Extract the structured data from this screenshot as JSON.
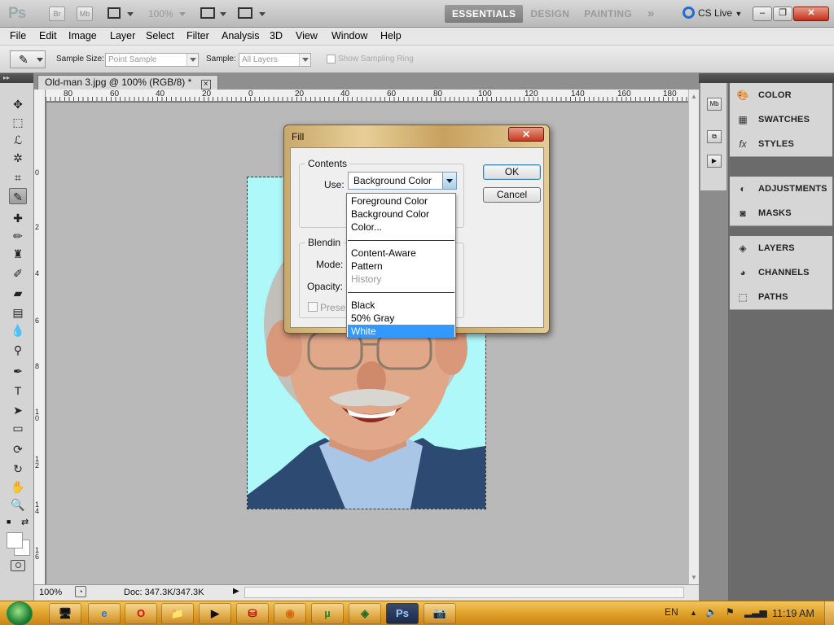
{
  "app": {
    "logo": "Ps",
    "zoom": "100%",
    "workspaces": [
      "ESSENTIALS",
      "DESIGN",
      "PAINTING"
    ],
    "active_workspace": "ESSENTIALS",
    "more": "»",
    "cs_live": "CS Live",
    "bridge_btn": "Br",
    "minibridge_btn": "Mb"
  },
  "menu": [
    "File",
    "Edit",
    "Image",
    "Layer",
    "Select",
    "Filter",
    "Analysis",
    "3D",
    "View",
    "Window",
    "Help"
  ],
  "options": {
    "sample_size_label": "Sample Size:",
    "sample_size_value": "Point Sample",
    "sample_label": "Sample:",
    "sample_value": "All Layers",
    "show_ring_label": "Show Sampling Ring"
  },
  "document": {
    "tab_title": "Old-man 3.jpg @ 100% (RGB/8) *",
    "close": "×",
    "ruler_top": [
      "80",
      "60",
      "40",
      "20",
      "0",
      "20",
      "40",
      "60",
      "80",
      "100",
      "120",
      "140",
      "160",
      "180"
    ],
    "ruler_left": [
      "0",
      "2",
      "4",
      "6",
      "8",
      "10",
      "12",
      "14",
      "16"
    ],
    "status_zoom": "100%",
    "status_doc": "Doc: 347.3K/347.3K"
  },
  "panels": {
    "group1": [
      {
        "label": "COLOR",
        "icon": "color-icon"
      },
      {
        "label": "SWATCHES",
        "icon": "swatches-icon"
      },
      {
        "label": "STYLES",
        "icon": "styles-icon"
      }
    ],
    "group2": [
      {
        "label": "ADJUSTMENTS",
        "icon": "adjustments-icon"
      },
      {
        "label": "MASKS",
        "icon": "masks-icon"
      }
    ],
    "group3": [
      {
        "label": "LAYERS",
        "icon": "layers-icon"
      },
      {
        "label": "CHANNELS",
        "icon": "channels-icon"
      },
      {
        "label": "PATHS",
        "icon": "paths-icon"
      }
    ]
  },
  "dialog": {
    "title": "Fill",
    "close": "✕",
    "contents_legend": "Contents",
    "use_label": "Use:",
    "use_value": "Background Color",
    "blending_legend": "Blendin",
    "mode_label": "Mode:",
    "opacity_label": "Opacity:",
    "preserve_label": "Preser",
    "ok": "OK",
    "cancel": "Cancel"
  },
  "dropdown": {
    "group1": [
      "Foreground Color",
      "Background Color",
      "Color..."
    ],
    "group2": [
      "Content-Aware",
      "Pattern",
      "History"
    ],
    "group3": [
      "Black",
      "50% Gray",
      "White"
    ],
    "disabled": "History",
    "selected": "White"
  },
  "taskbar": {
    "lang": "EN",
    "time": "11:19 AM"
  },
  "colors": {
    "photo_background": "#aff8fa",
    "selection_highlight": "#3399ff",
    "taskbar": "#e0a22c"
  }
}
